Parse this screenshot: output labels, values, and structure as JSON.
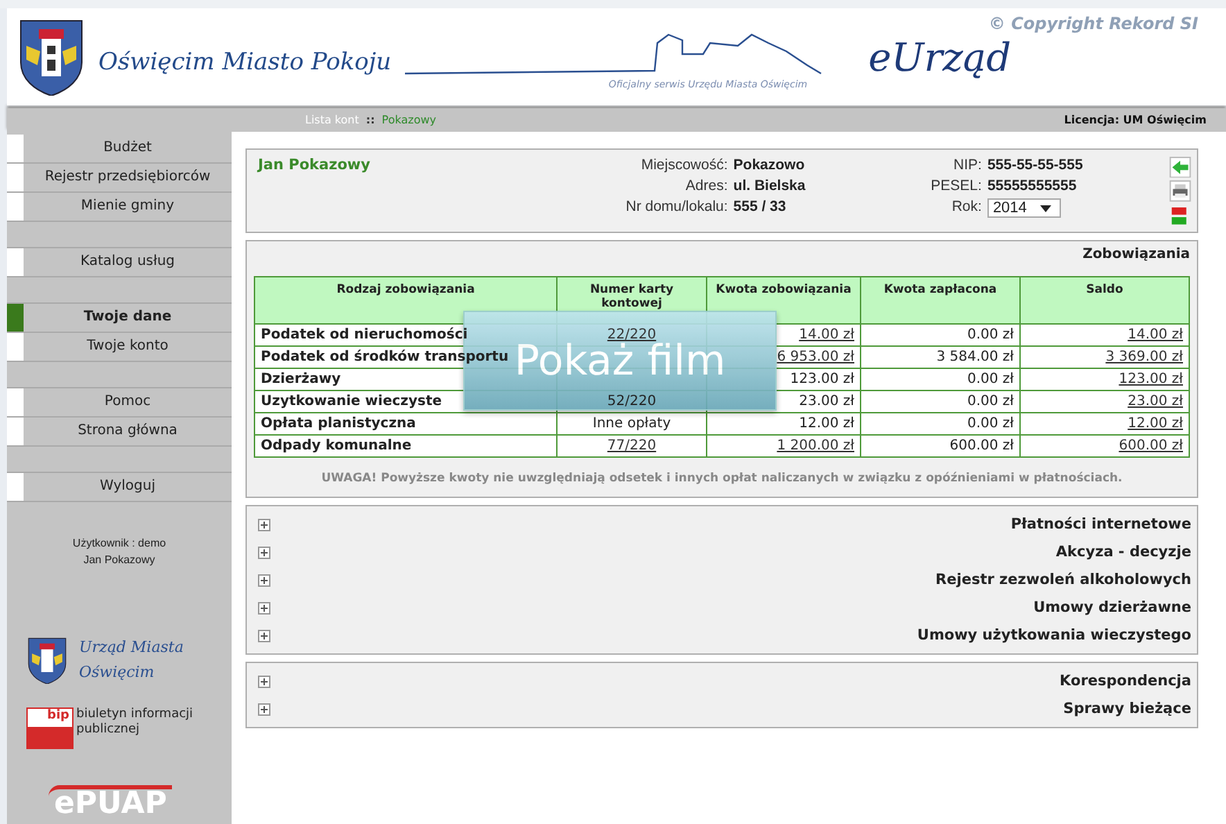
{
  "header": {
    "city_motto": "Oświęcim Miasto Pokoju",
    "subtitle": "Oficjalny serwis Urzędu Miasta Oświęcim",
    "app_name": "eUrząd",
    "copyright": "© Copyright Rekord SI"
  },
  "breadcrumb": {
    "items": [
      "Lista kont",
      "Pokazowy"
    ],
    "separator": "::",
    "license": "Licencja: UM Oświęcim"
  },
  "sidebar": {
    "groups": [
      [
        {
          "label": "Budżet",
          "selected": false
        },
        {
          "label": "Rejestr przedsiębiorców",
          "selected": false
        },
        {
          "label": "Mienie gminy",
          "selected": false
        }
      ],
      [
        {
          "label": "Katalog usług",
          "selected": false
        }
      ],
      [
        {
          "label": "Twoje dane",
          "selected": true
        },
        {
          "label": "Twoje konto",
          "selected": false
        }
      ],
      [
        {
          "label": "Pomoc",
          "selected": false
        },
        {
          "label": "Strona główna",
          "selected": false
        }
      ],
      [
        {
          "label": "Wyloguj",
          "selected": false
        }
      ]
    ],
    "user": [
      "Użytkownik : demo",
      "Jan Pokazowy"
    ],
    "logos": {
      "city": "Urząd Miasta Oświęcim",
      "bip_mark": "bip",
      "bip_text": "biuletyn informacji publicznej",
      "epuap": "ePUAP"
    }
  },
  "profile": {
    "name": "Jan Pokazowy",
    "fields_left": [
      {
        "label": "Miejscowość:",
        "value": "Pokazowo"
      },
      {
        "label": "Adres:",
        "value": "ul. Bielska"
      },
      {
        "label": "Nr domu/lokalu:",
        "value": "555 / 33"
      }
    ],
    "fields_right": [
      {
        "label": "NIP:",
        "value": "555-55-55-555"
      },
      {
        "label": "PESEL:",
        "value": "55555555555"
      }
    ],
    "year": {
      "label": "Rok:",
      "value": "2014"
    }
  },
  "obligations": {
    "title": "Zobowiązania",
    "columns": [
      "Rodzaj zobowiązania",
      "Numer karty kontowej",
      "Kwota zobowiązania",
      "Kwota zapłacona",
      "Saldo"
    ],
    "rows": [
      {
        "name": "Podatek od nieruchomości",
        "card": {
          "text": "22/220",
          "link": true
        },
        "amount": {
          "text": "14.00 zł",
          "link": true
        },
        "paid": "0.00 zł",
        "balance": {
          "text": "14.00 zł",
          "link": true
        }
      },
      {
        "name": "Podatek od środków transportu",
        "amount": {
          "text": "6 953.00 zł",
          "link": true
        },
        "paid": "3 584.00 zł",
        "balance": {
          "text": "3 369.00 zł",
          "link": true
        }
      },
      {
        "name": "Dzierżawy",
        "amount": {
          "text": "123.00 zł",
          "link": false
        },
        "paid": "0.00 zł",
        "balance": {
          "text": "123.00 zł",
          "link": true
        }
      },
      {
        "name": "Uzytkowanie wieczyste",
        "card": {
          "text": "52/220",
          "link": false
        },
        "amount": {
          "text": "23.00 zł",
          "link": false
        },
        "paid": "0.00 zł",
        "balance": {
          "text": "23.00 zł",
          "link": true
        }
      },
      {
        "name": "Opłata planistyczna",
        "card": {
          "text": "Inne opłaty",
          "link": false
        },
        "amount": {
          "text": "12.00 zł",
          "link": false
        },
        "paid": "0.00 zł",
        "balance": {
          "text": "12.00 zł",
          "link": true
        }
      },
      {
        "name": "Odpady komunalne",
        "card": {
          "text": "77/220",
          "link": true
        },
        "amount": {
          "text": "1 200.00 zł",
          "link": true
        },
        "paid": "600.00 zł",
        "balance": {
          "text": "600.00 zł",
          "link": true
        }
      }
    ],
    "note": "UWAGA! Powyższe kwoty nie uwzględniają odsetek i innych opłat naliczanych w związku z opóźnieniami w płatnościach."
  },
  "video_overlay": {
    "label": "Pokaż film"
  },
  "sections": [
    [
      {
        "label": "Płatności internetowe",
        "expanded": false
      },
      {
        "label": "Akcyza - decyzje",
        "expanded": false
      },
      {
        "label": "Rejestr zezwoleń alkoholowych",
        "expanded": false
      },
      {
        "label": "Umowy dzierżawne",
        "expanded": false
      },
      {
        "label": "Umowy użytkowania wieczystego",
        "expanded": false
      }
    ],
    [
      {
        "label": "Korespondencja",
        "expanded": false
      },
      {
        "label": "Sprawy bieżące",
        "expanded": false
      }
    ]
  ]
}
